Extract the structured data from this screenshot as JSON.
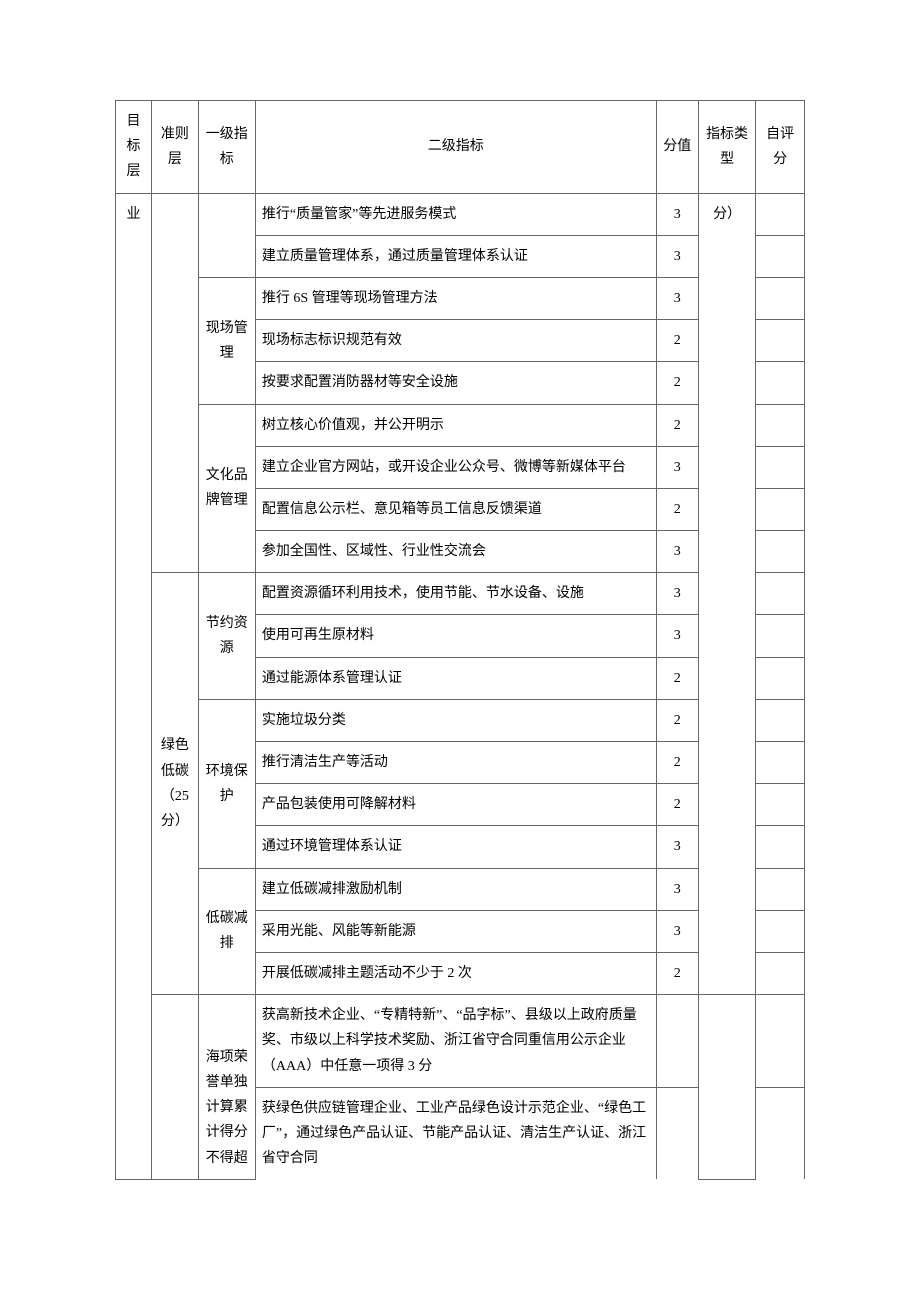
{
  "header": {
    "col_goal": "目标层",
    "col_criteria": "准则层",
    "col_primary": "一级指标",
    "col_secondary": "二级指标",
    "col_score": "分值",
    "col_type": "指标类型",
    "col_self": "自评分"
  },
  "goal_cell": "业",
  "type_cell_top": "分）",
  "criteria_green": "绿色低碳（25分）",
  "primary_site": "现场管理",
  "primary_culture": "文化品牌管理",
  "primary_save": "节约资源",
  "primary_env": "环境保护",
  "primary_lowc": "低碳减排",
  "primary_honor": "海项荣誉单独计算累计得分 不得超",
  "rows": [
    {
      "sec": "推行“质量管家”等先进服务模式",
      "score": "3"
    },
    {
      "sec": "建立质量管理体系，通过质量管理体系认证",
      "score": "3"
    },
    {
      "sec": "推行 6S 管理等现场管理方法",
      "score": "3"
    },
    {
      "sec": "现场标志标识规范有效",
      "score": "2"
    },
    {
      "sec": "按要求配置消防器材等安全设施",
      "score": "2"
    },
    {
      "sec": "树立核心价值观，并公开明示",
      "score": "2"
    },
    {
      "sec": "建立企业官方网站，或开设企业公众号、微博等新媒体平台",
      "score": "3"
    },
    {
      "sec": "配置信息公示栏、意见箱等员工信息反馈渠道",
      "score": "2"
    },
    {
      "sec": "参加全国性、区域性、行业性交流会",
      "score": "3"
    },
    {
      "sec": "配置资源循环利用技术，使用节能、节水设备、设施",
      "score": "3"
    },
    {
      "sec": "使用可再生原材料",
      "score": "3"
    },
    {
      "sec": "通过能源体系管理认证",
      "score": "2"
    },
    {
      "sec": "实施垃圾分类",
      "score": "2"
    },
    {
      "sec": "推行清洁生产等活动",
      "score": "2"
    },
    {
      "sec": "产品包装使用可降解材料",
      "score": "2"
    },
    {
      "sec": "通过环境管理体系认证",
      "score": "3"
    },
    {
      "sec": "建立低碳减排激励机制",
      "score": "3"
    },
    {
      "sec": "采用光能、风能等新能源",
      "score": "3"
    },
    {
      "sec": "开展低碳减排主题活动不少于 2 次",
      "score": "2"
    },
    {
      "sec": "获高新技术企业、“专精特新”、“品字标”、县级以上政府质量奖、市级以上科学技术奖励、浙江省守合同重信用公示企业（AAA）中任意一项得 3 分",
      "score": ""
    },
    {
      "sec": "获绿色供应链管理企业、工业产品绿色设计示范企业、“绿色工厂”，通过绿色产品认证、节能产品认证、清洁生产认证、浙江省守合同",
      "score": ""
    }
  ]
}
